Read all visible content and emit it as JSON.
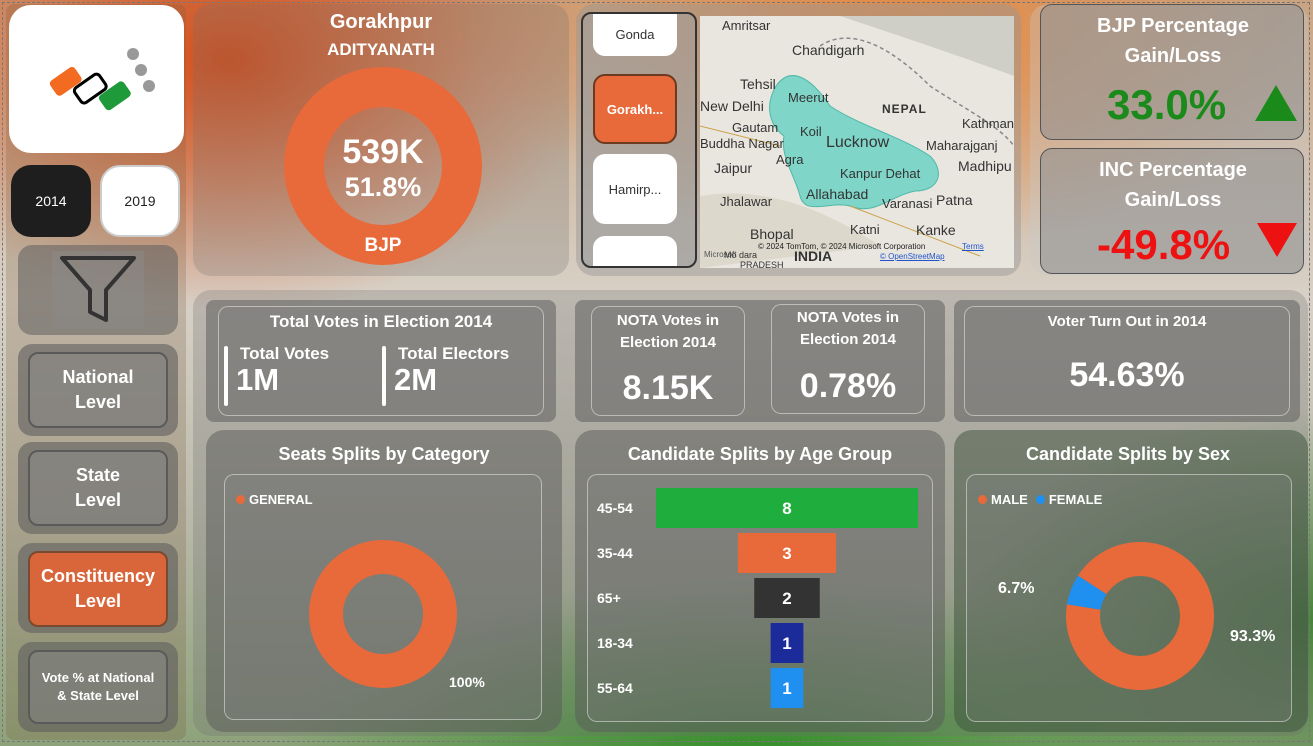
{
  "years": [
    "2014",
    "2019"
  ],
  "nav": {
    "national": "National Level",
    "state": "State Level",
    "constituency": "Constituency Level",
    "vote_pct": "Vote % at National & State Level"
  },
  "winner": {
    "constituency": "Gorakhpur",
    "candidate": "ADITYANATH",
    "votes": "539K",
    "share": "51.8%",
    "party": "BJP"
  },
  "constituency_list": [
    "Gonda",
    "Gorakh...",
    "Hamirp..."
  ],
  "map": {
    "labels": [
      "Amritsar",
      "Chandigarh",
      "Tehsil",
      "New Delhi",
      "Meerut",
      "NEPAL",
      "Kathman",
      "Gautam",
      "Buddha Nagar",
      "Koil",
      "Lucknow",
      "Maharajganj",
      "Agra",
      "Madhipu",
      "Jaipur",
      "Kanpur Dehat",
      "Allahabad",
      "Patna",
      "Jhalawar",
      "Varanasi",
      "Katni",
      "Kanke",
      "Bhopal",
      "INDIA",
      "Mo dara",
      "PRADESH"
    ],
    "credit": "© 2024 TomTom, © 2024 Microsoft Corporation",
    "terms": "Terms",
    "osm": "© OpenStreetMap",
    "brand": "Microsoft"
  },
  "bjp": {
    "title": "BJP Percentage Gain/Loss",
    "value": "33.0%",
    "color": "#1a8a1a"
  },
  "inc": {
    "title": "INC Percentage Gain/Loss",
    "value": "-49.8%",
    "color": "#ee1111"
  },
  "totals": {
    "title": "Total Votes in Election 2014",
    "votes_label": "Total Votes",
    "votes": "1M",
    "electors_label": "Total Electors",
    "electors": "2M"
  },
  "nota": {
    "votes_title": "NOTA Votes in Election 2014",
    "votes": "8.15K",
    "pct_title": "NOTA Votes in Election 2014",
    "pct": "0.78%"
  },
  "turnout": {
    "title": "Voter Turn Out in 2014",
    "value": "54.63%"
  },
  "chart_data": [
    {
      "type": "pie",
      "title": "Seats Splits by Category",
      "categories": [
        "GENERAL"
      ],
      "values": [
        100
      ],
      "labels": [
        "100%"
      ],
      "colors": [
        "#e8693a"
      ]
    },
    {
      "type": "bar",
      "title": "Candidate Splits by Age Group",
      "categories": [
        "45-54",
        "35-44",
        "65+",
        "18-34",
        "55-64"
      ],
      "values": [
        8,
        3,
        2,
        1,
        1
      ],
      "colors": [
        "#1fae3e",
        "#e8693a",
        "#333333",
        "#1b2b9a",
        "#1f8ff0"
      ]
    },
    {
      "type": "pie",
      "title": "Candidate Splits by Sex",
      "categories": [
        "MALE",
        "FEMALE"
      ],
      "values": [
        93.3,
        6.7
      ],
      "labels": [
        "93.3%",
        "6.7%"
      ],
      "colors": [
        "#e8693a",
        "#1f8ff0"
      ]
    }
  ]
}
